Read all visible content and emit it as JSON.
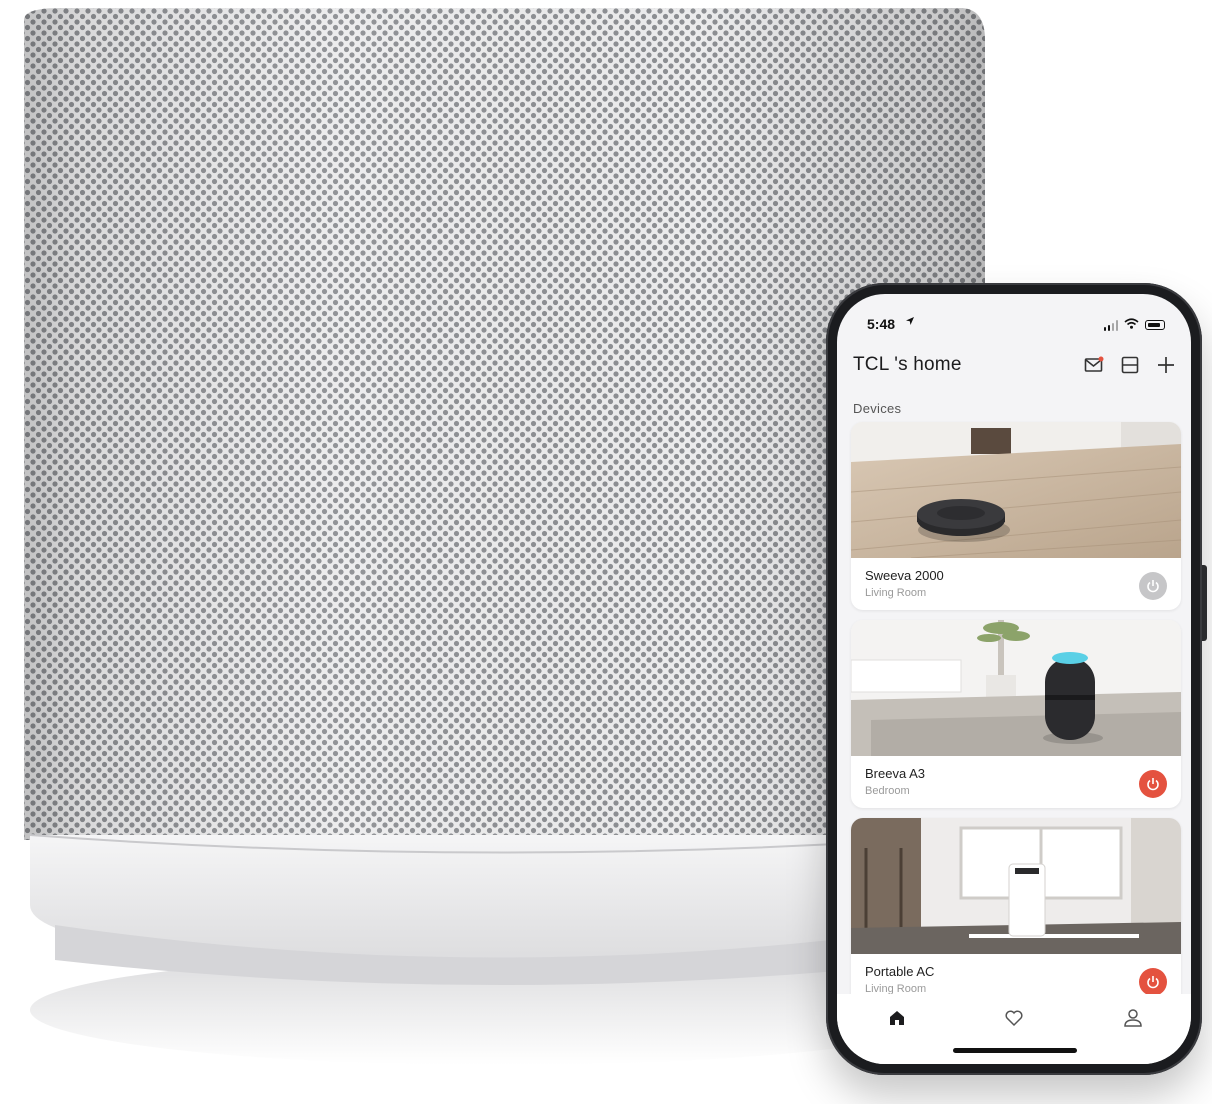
{
  "status_bar": {
    "time": "5:48",
    "location_icon": "location-arrow-icon",
    "signal_icon": "signal-bars-icon",
    "wifi_icon": "wifi-icon",
    "battery_icon": "battery-icon"
  },
  "header": {
    "title": "TCL 's home",
    "icons": [
      "mail-icon",
      "scan-icon",
      "plus-icon"
    ]
  },
  "section_label": "Devices",
  "devices": [
    {
      "name": "Sweeva 2000",
      "room": "Living Room",
      "power_state": "off",
      "power_color": "#c6c6c8"
    },
    {
      "name": "Breeva A3",
      "room": "Bedroom",
      "power_state": "on",
      "power_color": "#e4523f"
    },
    {
      "name": "Portable AC",
      "room": "Living Room",
      "power_state": "on",
      "power_color": "#e4523f"
    }
  ],
  "tabs": [
    {
      "icon": "home-icon",
      "active": true
    },
    {
      "icon": "heart-icon",
      "active": false
    },
    {
      "icon": "user-icon",
      "active": false
    }
  ],
  "colors": {
    "accent_power_on": "#e4523f",
    "power_off": "#c6c6c8",
    "phone_frame": "#1b1c1f",
    "screen_bg": "#f4f4f6"
  }
}
